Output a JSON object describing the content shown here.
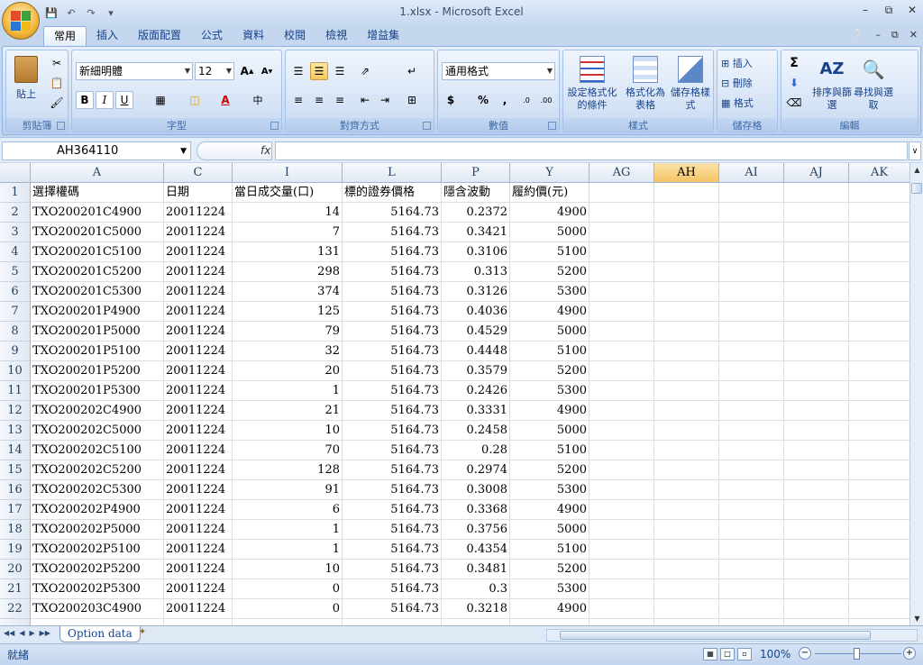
{
  "window": {
    "title": "1.xlsx - Microsoft Excel"
  },
  "ribbon": {
    "tabs": [
      "常用",
      "插入",
      "版面配置",
      "公式",
      "資料",
      "校閱",
      "檢視",
      "增益集"
    ],
    "active_tab": "常用",
    "clipboard": {
      "label": "剪貼簿",
      "paste": "貼上"
    },
    "font": {
      "label": "字型",
      "name": "新細明體",
      "size": "12"
    },
    "alignment": {
      "label": "對齊方式"
    },
    "number": {
      "label": "數值",
      "format": "通用格式"
    },
    "styles": {
      "label": "樣式",
      "conditional": "設定格式化的條件",
      "as_table": "格式化為表格",
      "cell_styles": "儲存格樣式"
    },
    "cells": {
      "label": "儲存格",
      "insert": "插入",
      "delete": "刪除",
      "format": "格式"
    },
    "editing": {
      "label": "編輯",
      "sort": "排序與篩選",
      "find": "尋找與選取"
    }
  },
  "formula_bar": {
    "name_box": "AH364110",
    "fx": "fx",
    "content": ""
  },
  "columns": [
    "A",
    "C",
    "I",
    "L",
    "P",
    "Y",
    "AG",
    "AH",
    "AI",
    "AJ",
    "AK"
  ],
  "active_column": "AH",
  "rows": [
    {
      "n": "1",
      "a": "選擇權碼",
      "c": "日期",
      "i": "當日成交量(口)",
      "l": "標的證券價格",
      "p": "隱含波動",
      "y": "履約價(元)"
    },
    {
      "n": "2",
      "a": "TXO200201C4900",
      "c": "20011224",
      "i": "14",
      "l": "5164.73",
      "p": "0.2372",
      "y": "4900"
    },
    {
      "n": "3",
      "a": "TXO200201C5000",
      "c": "20011224",
      "i": "7",
      "l": "5164.73",
      "p": "0.3421",
      "y": "5000"
    },
    {
      "n": "4",
      "a": "TXO200201C5100",
      "c": "20011224",
      "i": "131",
      "l": "5164.73",
      "p": "0.3106",
      "y": "5100"
    },
    {
      "n": "5",
      "a": "TXO200201C5200",
      "c": "20011224",
      "i": "298",
      "l": "5164.73",
      "p": "0.313",
      "y": "5200"
    },
    {
      "n": "6",
      "a": "TXO200201C5300",
      "c": "20011224",
      "i": "374",
      "l": "5164.73",
      "p": "0.3126",
      "y": "5300"
    },
    {
      "n": "7",
      "a": "TXO200201P4900",
      "c": "20011224",
      "i": "125",
      "l": "5164.73",
      "p": "0.4036",
      "y": "4900"
    },
    {
      "n": "8",
      "a": "TXO200201P5000",
      "c": "20011224",
      "i": "79",
      "l": "5164.73",
      "p": "0.4529",
      "y": "5000"
    },
    {
      "n": "9",
      "a": "TXO200201P5100",
      "c": "20011224",
      "i": "32",
      "l": "5164.73",
      "p": "0.4448",
      "y": "5100"
    },
    {
      "n": "10",
      "a": "TXO200201P5200",
      "c": "20011224",
      "i": "20",
      "l": "5164.73",
      "p": "0.3579",
      "y": "5200"
    },
    {
      "n": "11",
      "a": "TXO200201P5300",
      "c": "20011224",
      "i": "1",
      "l": "5164.73",
      "p": "0.2426",
      "y": "5300"
    },
    {
      "n": "12",
      "a": "TXO200202C4900",
      "c": "20011224",
      "i": "21",
      "l": "5164.73",
      "p": "0.3331",
      "y": "4900"
    },
    {
      "n": "13",
      "a": "TXO200202C5000",
      "c": "20011224",
      "i": "10",
      "l": "5164.73",
      "p": "0.2458",
      "y": "5000"
    },
    {
      "n": "14",
      "a": "TXO200202C5100",
      "c": "20011224",
      "i": "70",
      "l": "5164.73",
      "p": "0.28",
      "y": "5100"
    },
    {
      "n": "15",
      "a": "TXO200202C5200",
      "c": "20011224",
      "i": "128",
      "l": "5164.73",
      "p": "0.2974",
      "y": "5200"
    },
    {
      "n": "16",
      "a": "TXO200202C5300",
      "c": "20011224",
      "i": "91",
      "l": "5164.73",
      "p": "0.3008",
      "y": "5300"
    },
    {
      "n": "17",
      "a": "TXO200202P4900",
      "c": "20011224",
      "i": "6",
      "l": "5164.73",
      "p": "0.3368",
      "y": "4900"
    },
    {
      "n": "18",
      "a": "TXO200202P5000",
      "c": "20011224",
      "i": "1",
      "l": "5164.73",
      "p": "0.3756",
      "y": "5000"
    },
    {
      "n": "19",
      "a": "TXO200202P5100",
      "c": "20011224",
      "i": "1",
      "l": "5164.73",
      "p": "0.4354",
      "y": "5100"
    },
    {
      "n": "20",
      "a": "TXO200202P5200",
      "c": "20011224",
      "i": "10",
      "l": "5164.73",
      "p": "0.3481",
      "y": "5200"
    },
    {
      "n": "21",
      "a": "TXO200202P5300",
      "c": "20011224",
      "i": "0",
      "l": "5164.73",
      "p": "0.3",
      "y": "5300"
    },
    {
      "n": "22",
      "a": "TXO200203C4900",
      "c": "20011224",
      "i": "0",
      "l": "5164.73",
      "p": "0.3218",
      "y": "4900"
    }
  ],
  "sheet_tab": "Option data",
  "status": {
    "text": "就緒",
    "zoom": "100%"
  }
}
